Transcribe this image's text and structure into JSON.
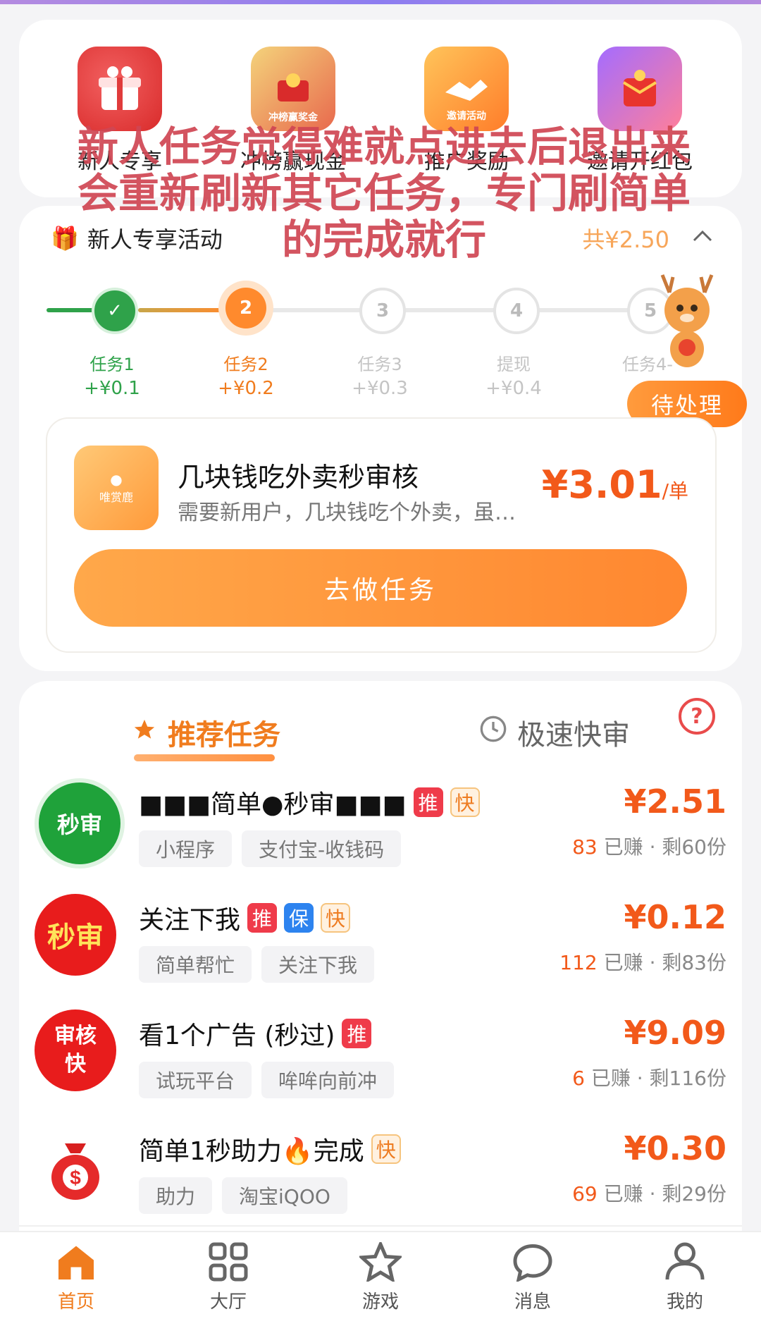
{
  "quick_entries": [
    {
      "label": "新人专享",
      "icon": "gift-box-icon",
      "sub": ""
    },
    {
      "label": "冲榜赢现金",
      "icon": "trophy-gift-icon",
      "sub": "冲榜赢奖金"
    },
    {
      "label": "推广奖励",
      "icon": "handshake-icon",
      "sub": "邀请活动"
    },
    {
      "label": "邀请开红包",
      "icon": "red-envelope-icon",
      "sub": ""
    }
  ],
  "overlay_text": "新人任务觉得难就点进去后退出来会重新刷新其它任务，专门刷简单的完成就行",
  "newbie": {
    "title": "新人专享活动",
    "total": "共¥2.50",
    "steps": [
      {
        "name": "任务1",
        "reward": "+¥0.1",
        "node": "✓",
        "state": "done"
      },
      {
        "name": "任务2",
        "reward": "+¥0.2",
        "node": "2",
        "state": "current"
      },
      {
        "name": "任务3",
        "reward": "+¥0.3",
        "node": "3",
        "state": "future"
      },
      {
        "name": "提现",
        "reward": "+¥0.4",
        "node": "4",
        "state": "future"
      },
      {
        "name": "任务4-",
        "reward": "+¥",
        "node": "5",
        "state": "future"
      }
    ],
    "pending_label": "待处理",
    "task": {
      "logo_text": "唯赏鹿",
      "title": "几块钱吃外卖秒审核",
      "desc": "需要新用户，几块钱吃个外卖，虽…",
      "price": "¥3.01",
      "unit": "/单",
      "button": "去做任务"
    }
  },
  "tabs": {
    "recommended": "推荐任务",
    "fast": "极速快审",
    "help": "?"
  },
  "tasks": [
    {
      "title": "■■■简单●秒审■■■",
      "badges": [
        "推",
        "快"
      ],
      "tags": [
        "小程序",
        "支付宝-收钱码"
      ],
      "price": "¥2.51",
      "earned": "83",
      "earned_label": "已赚",
      "remaining": "· 剩60份",
      "icon_text": "秒审",
      "icon": "lightning-icon"
    },
    {
      "title": "关注下我",
      "badges": [
        "推",
        "保",
        "快"
      ],
      "tags": [
        "简单帮忙",
        "关注下我"
      ],
      "price": "¥0.12",
      "earned": "112",
      "earned_label": "已赚",
      "remaining": "· 剩83份",
      "icon_text": "秒审",
      "icon": ""
    },
    {
      "title": "看1个广告 (秒过)",
      "badges": [
        "推"
      ],
      "tags": [
        "试玩平台",
        "哞哞向前冲"
      ],
      "price": "¥9.09",
      "earned": "6",
      "earned_label": "已赚",
      "remaining": "· 剩116份",
      "icon_text": "审核快",
      "icon": ""
    },
    {
      "title": "简单1秒助力🔥完成",
      "badges": [
        "快"
      ],
      "tags": [
        "助力",
        "淘宝iQOO"
      ],
      "price": "¥0.30",
      "earned": "69",
      "earned_label": "已赚",
      "remaining": "· 剩29份",
      "icon_text": "",
      "icon": "money-bag-icon"
    }
  ],
  "nav": [
    {
      "label": "首页",
      "icon": "home-icon",
      "active": true
    },
    {
      "label": "大厅",
      "icon": "grid-icon",
      "active": false
    },
    {
      "label": "游戏",
      "icon": "star-icon",
      "active": false
    },
    {
      "label": "消息",
      "icon": "chat-icon",
      "active": false
    },
    {
      "label": "我的",
      "icon": "user-icon",
      "active": false
    }
  ],
  "colors": {
    "accent": "#f07c1e",
    "price": "#f2591a",
    "overlay": "#d04653",
    "done": "#2fa24a"
  }
}
